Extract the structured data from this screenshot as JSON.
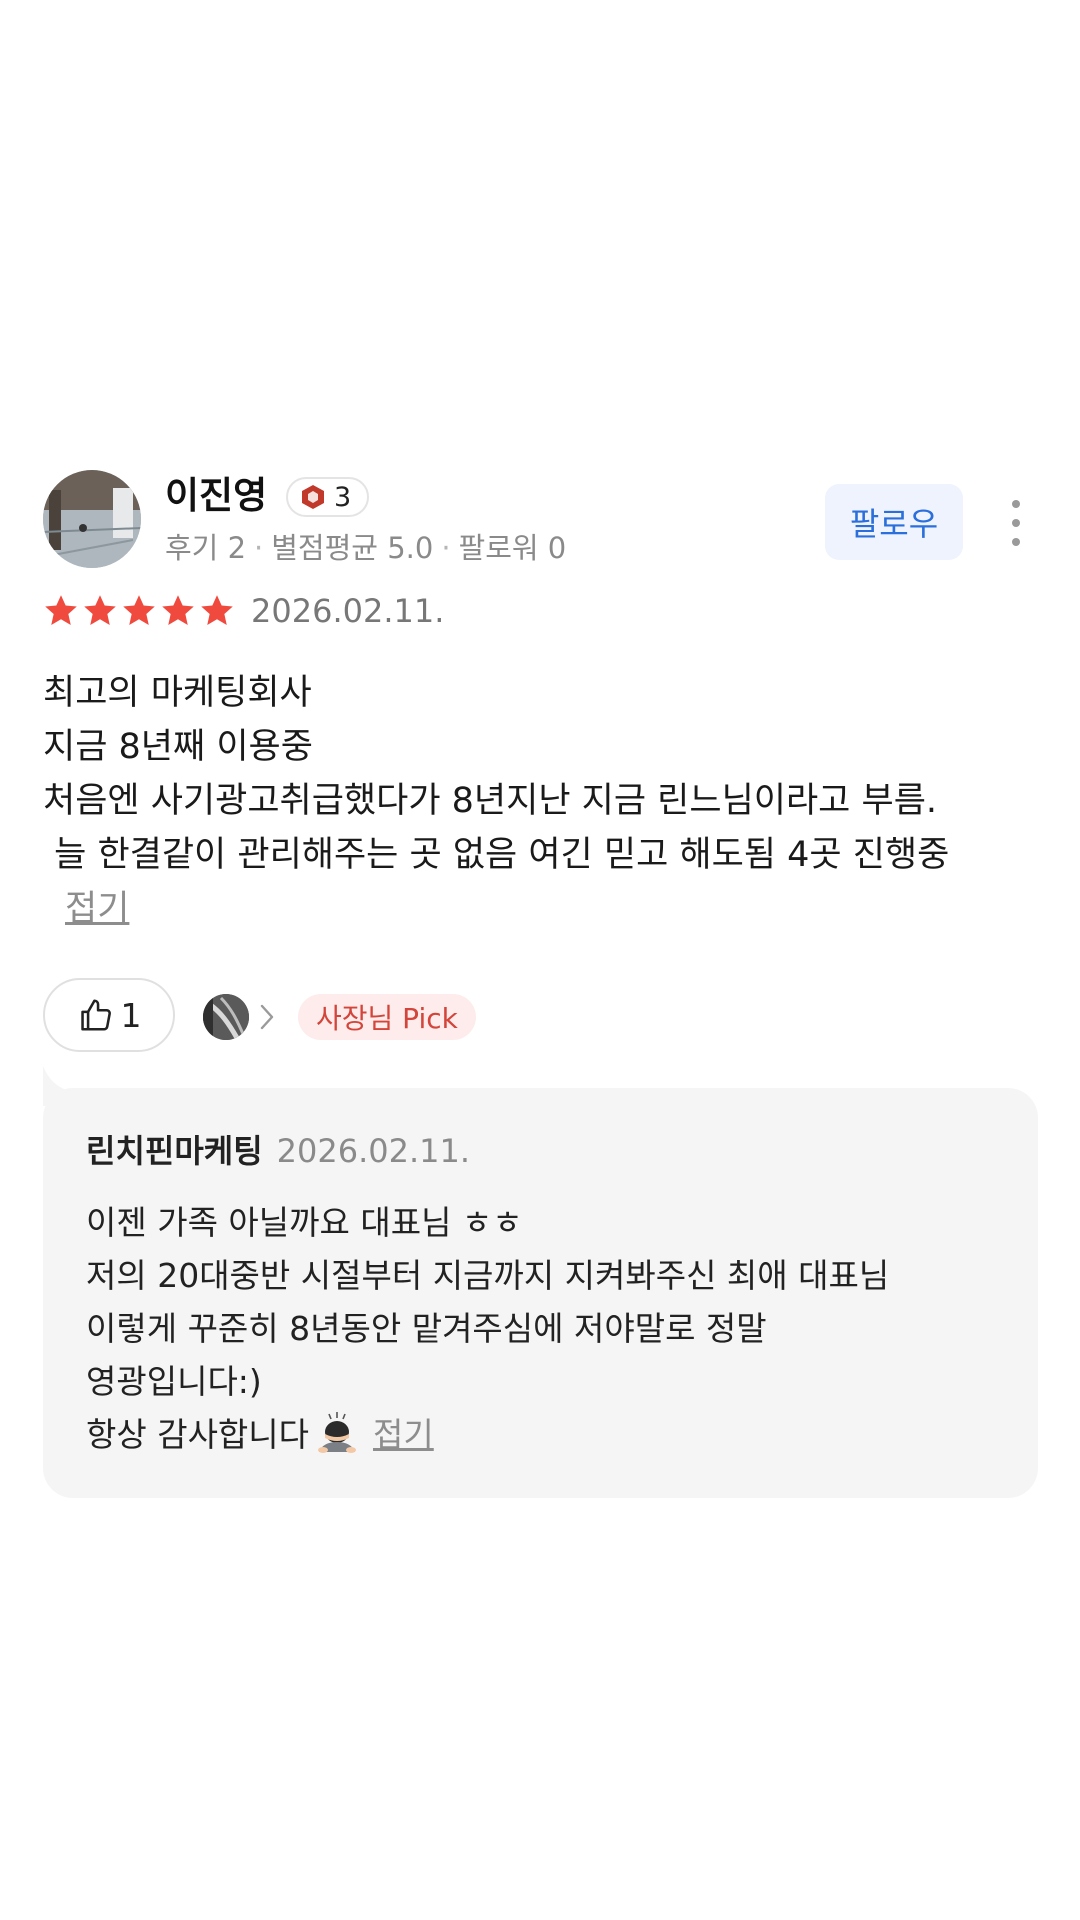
{
  "review": {
    "user": {
      "name": "이진영",
      "level": "3",
      "reviews_label": "후기 2",
      "avg_rating_label": "별점평균 5.0",
      "followers_label": "팔로워 0"
    },
    "follow_label": "팔로우",
    "rating": 5,
    "date": "2026.02.11.",
    "body_lines": [
      "최고의 마케팅회사",
      "지금 8년째 이용중",
      "처음엔 사기광고취급했다가 8년지난 지금 린느님이라고 부름.",
      " 늘 한결같이 관리해주는 곳 없음 여긴 믿고 해도됨 4곳 진행중"
    ],
    "collapse_label": "접기",
    "like_count": "1",
    "owner_pick_label": "사장님 Pick",
    "colors": {
      "star": "#f04a3e",
      "follow_text": "#2a6fdb",
      "owner_pick": "#d3453a"
    }
  },
  "reply": {
    "author": "린치핀마케팅",
    "date": "2026.02.11.",
    "lines": [
      "이젠 가족 아닐까요 대표님 ㅎㅎ",
      "저의 20대중반 시절부터 지금까지 지켜봐주신 최애 대표님",
      "이렇게 꾸준히 8년동안 맡겨주심에 저야말로 정말",
      "영광입니다:)",
      "항상 감사합니다"
    ],
    "collapse_label": "접기",
    "icon": "person-bowing-icon"
  }
}
